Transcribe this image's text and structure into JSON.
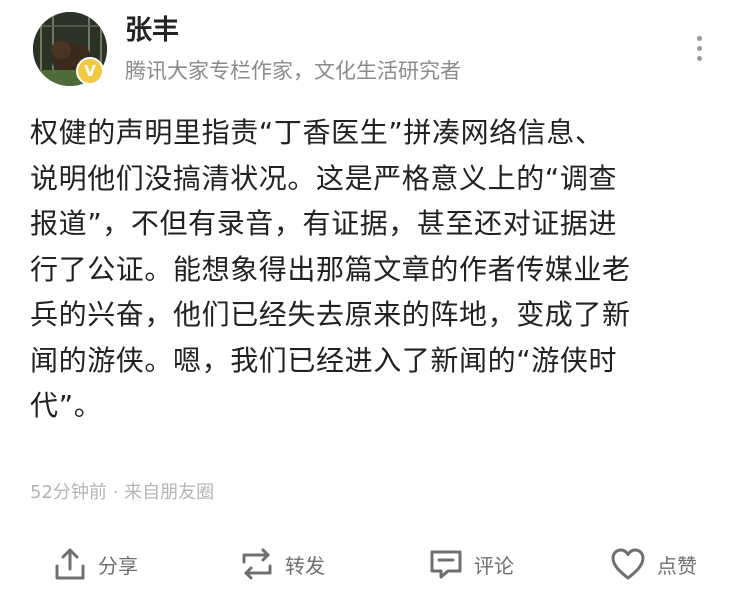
{
  "author": {
    "name": "张丰",
    "description": "腾讯大家专栏作家，文化生活研究者",
    "verified_badge": "V"
  },
  "post": {
    "lines": [
      "权健的声明里指责“丁香医生”拼凑网络信息、",
      "说明他们没搞清状况。这是严格意义上的“调查",
      "报道”，不但有录音，有证据，甚至还对证据进",
      "行了公证。能想象得出那篇文章的作者传媒业老",
      "兵的兴奋，他们已经失去原来的阵地，变成了新",
      "闻的游侠。嗯，我们已经进入了新闻的“游侠时",
      "代”。"
    ],
    "meta": "52分钟前 · 来自朋友圈"
  },
  "actions": {
    "share": "分享",
    "repost": "转发",
    "comment": "评论",
    "like": "点赞"
  },
  "colors": {
    "text": "#222222",
    "secondary": "#8b8b8b",
    "meta": "#b4b4b4",
    "icon": "#6f6f6f",
    "badge": "#f3c845"
  }
}
